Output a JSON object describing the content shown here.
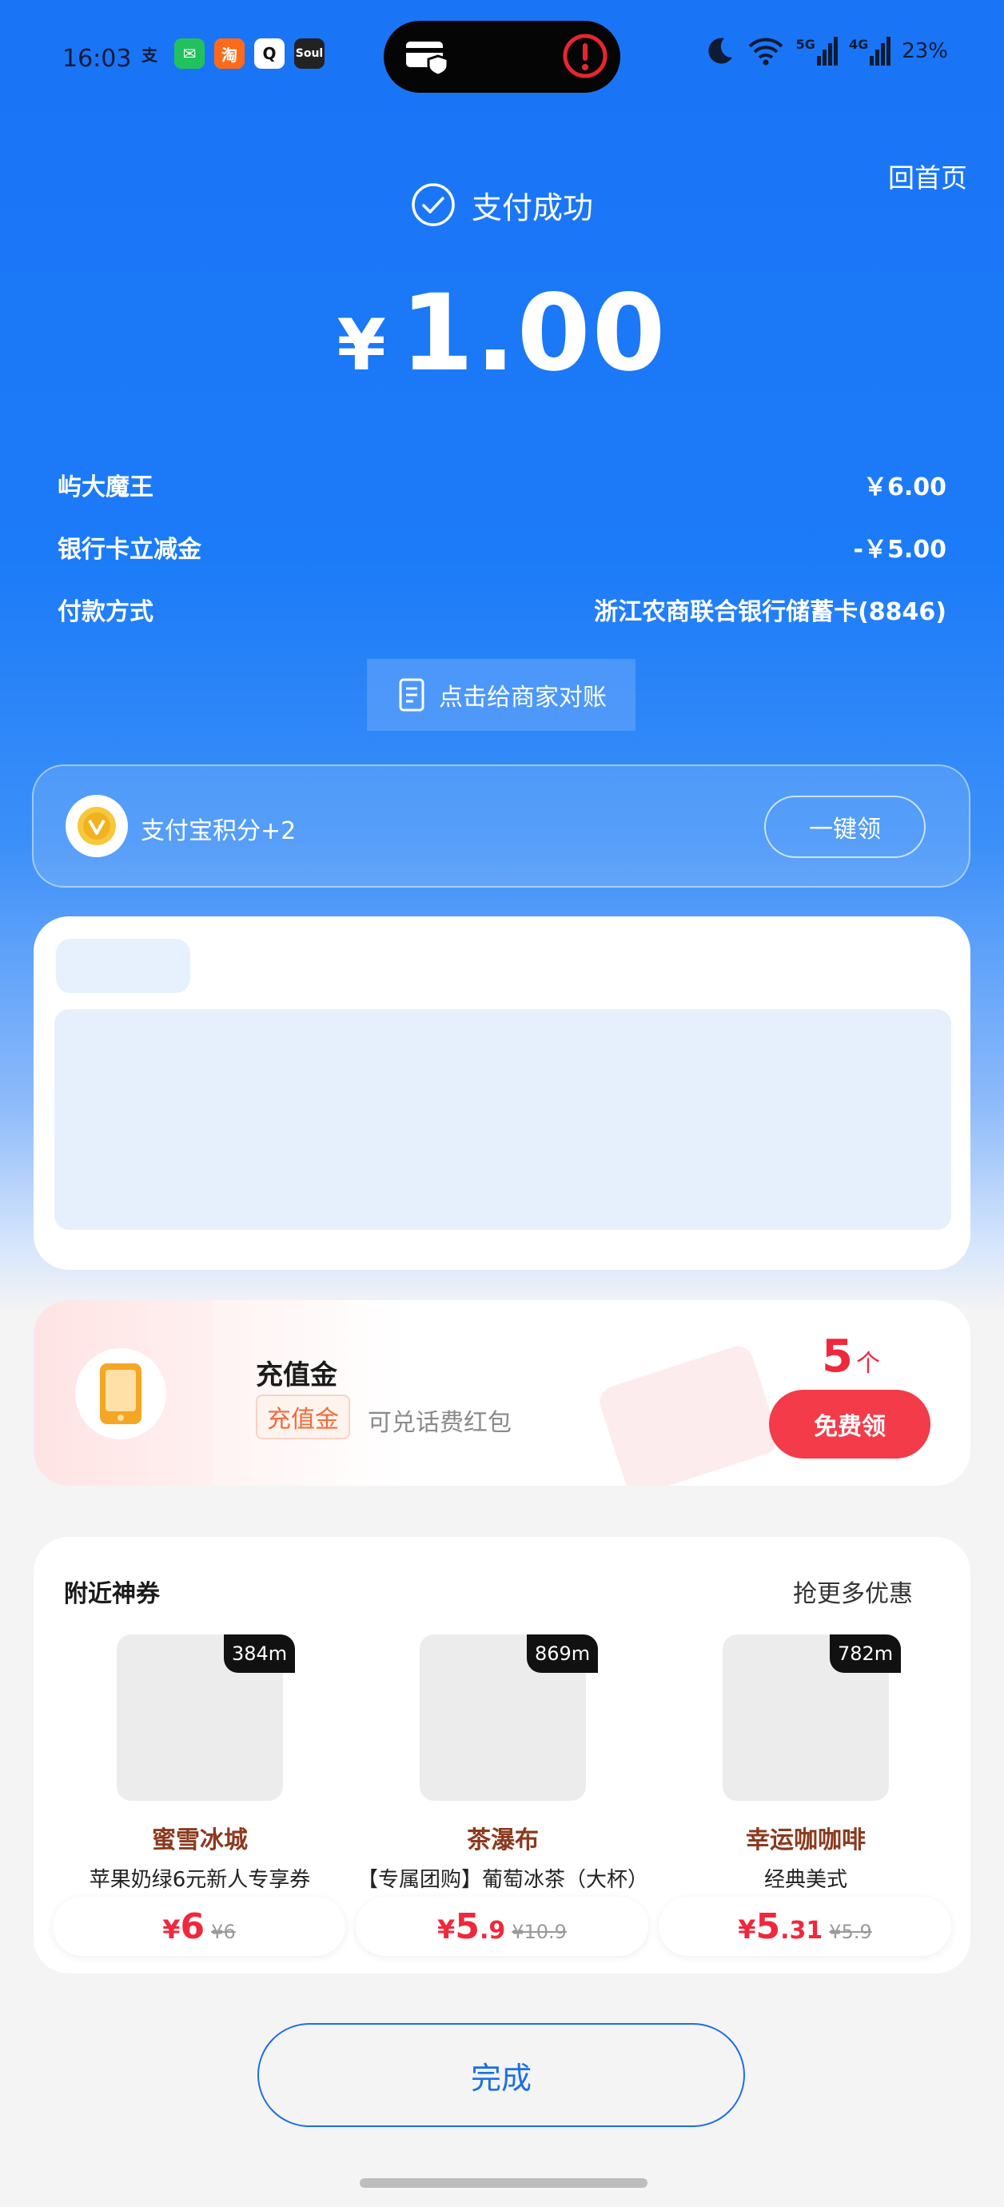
{
  "status_bar": {
    "time": "16:03",
    "apps": [
      {
        "icon": "alipay-icon",
        "glyph": "支",
        "color": "#1a74f6"
      },
      {
        "icon": "wechat-icon",
        "glyph": "✉",
        "color": "#22c15e"
      },
      {
        "icon": "taobao-icon",
        "glyph": "淘",
        "color": "#ff6a1a"
      },
      {
        "icon": "qq-icon",
        "glyph": "Q",
        "color": "#ffffff"
      },
      {
        "icon": "soul-icon",
        "glyph": "Soul",
        "color": "#222222"
      }
    ],
    "network_5g": "5G",
    "network_4g": "4G",
    "battery": "23%"
  },
  "header": {
    "home_link": "回首页",
    "success_text": "支付成功",
    "amount_symbol": "¥",
    "amount": "1.00"
  },
  "details": [
    {
      "label": "屿大魔王",
      "value": "￥6.00"
    },
    {
      "label": "银行卡立减金",
      "value": "-￥5.00"
    },
    {
      "label": "付款方式",
      "value": "浙江农商联合银行储蓄卡(8846)"
    }
  ],
  "reconcile_button": "点击给商家对账",
  "points": {
    "text": "支付宝积分+2",
    "button": "一键领"
  },
  "recharge": {
    "title": "充值金",
    "tag": "充值金",
    "desc": "可兑话费红包",
    "count": "5",
    "count_unit": "个",
    "button": "免费领"
  },
  "coupons": {
    "title": "附近神券",
    "more": "抢更多优惠",
    "items": [
      {
        "distance": "384m",
        "name": "蜜雪冰城",
        "desc": "苹果奶绿6元新人专享券",
        "currency": "¥",
        "price_int": "6",
        "price_dec": "",
        "old_price": "¥6"
      },
      {
        "distance": "869m",
        "name": "茶瀑布",
        "desc": "【专属团购】葡萄冰茶（大杯）",
        "currency": "¥",
        "price_int": "5",
        "price_dec": ".9",
        "old_price": "¥10.9"
      },
      {
        "distance": "782m",
        "name": "幸运咖咖啡",
        "desc": "经典美式",
        "currency": "¥",
        "price_int": "5",
        "price_dec": ".31",
        "old_price": "¥5.9"
      }
    ]
  },
  "done_button": "完成"
}
